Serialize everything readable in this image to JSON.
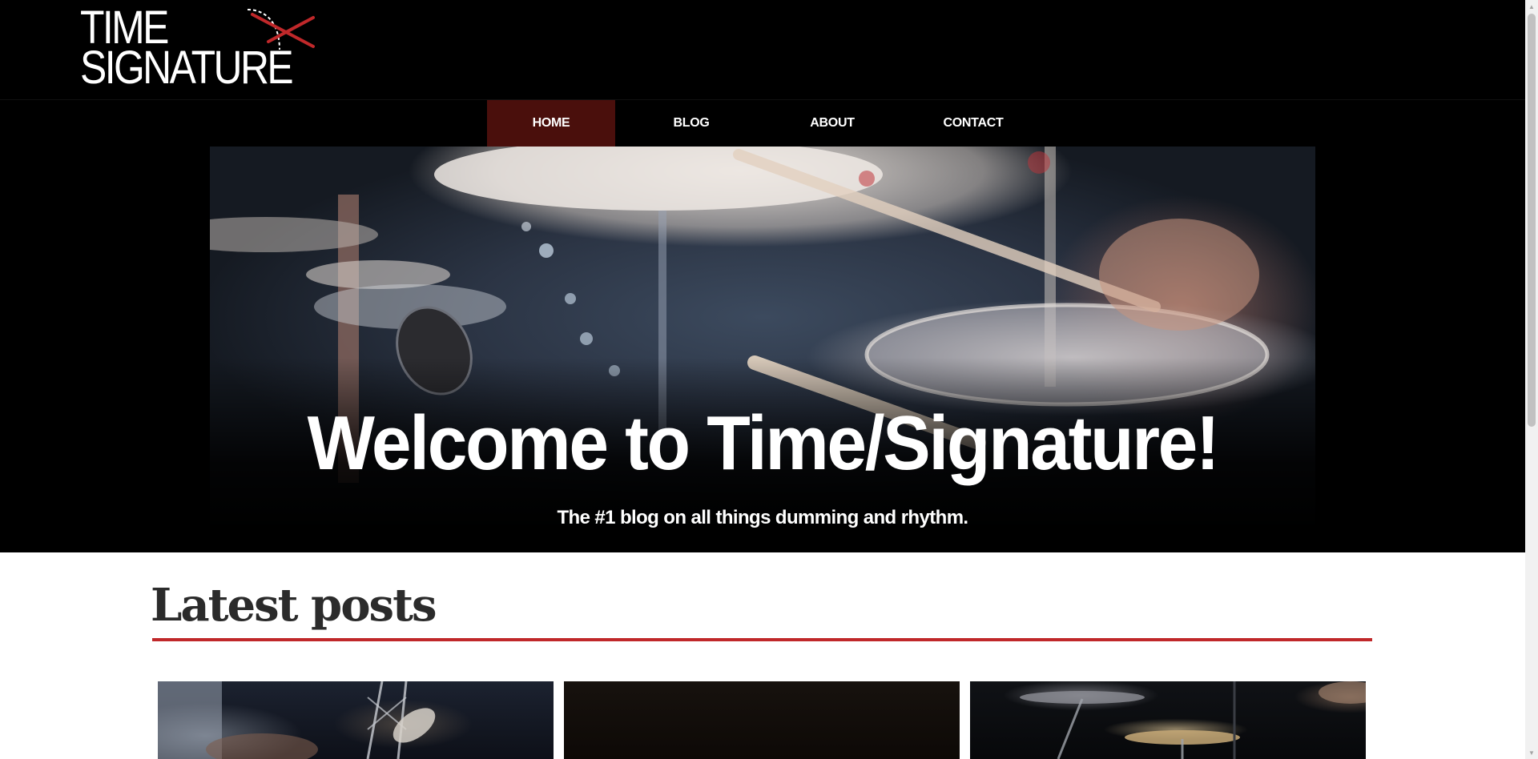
{
  "site": {
    "logo_line1": "TIME",
    "logo_line2": "SIGNATURE",
    "logo_accent_color": "#c0282a"
  },
  "nav": {
    "items": [
      {
        "label": "HOME",
        "active": true
      },
      {
        "label": "BLOG",
        "active": false
      },
      {
        "label": "ABOUT",
        "active": false
      },
      {
        "label": "CONTACT",
        "active": false
      }
    ],
    "active_color": "#4a0f0c"
  },
  "hero": {
    "title": "Welcome to Time/Signature!",
    "subtitle": "The #1 blog on all things dumming and rhythm.",
    "image": "drum-kit-photo"
  },
  "latest": {
    "title": "Latest posts",
    "rule_color": "#c0282a",
    "cards": [
      {
        "image": "bass-guitar-photo"
      },
      {
        "image": "dark-stage-photo"
      },
      {
        "image": "cymbals-photo"
      }
    ]
  }
}
